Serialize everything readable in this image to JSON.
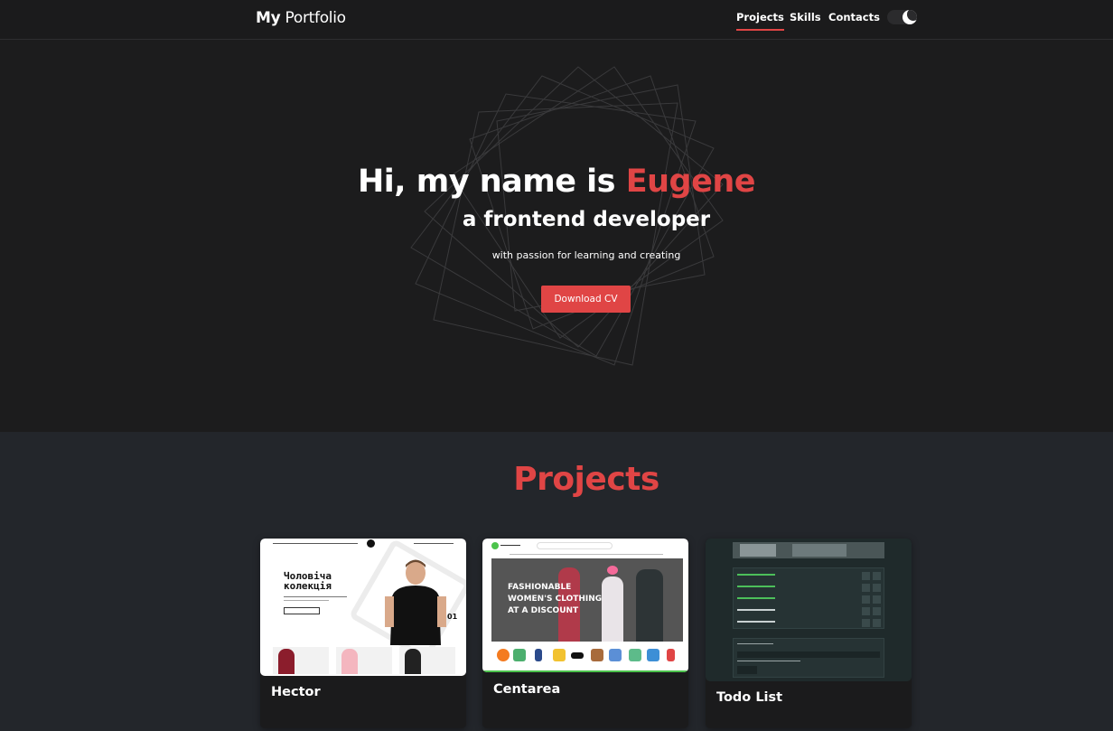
{
  "header": {
    "brand_bold": "My",
    "brand_rest": "Portfolio",
    "nav": [
      "Projects",
      "Skills",
      "Contacts"
    ],
    "active_nav": "Projects",
    "theme_toggle": "dark"
  },
  "hero": {
    "title_prefix": "Hi, my name is ",
    "title_name": "Eugene",
    "subtitle": "a frontend developer",
    "tagline": "with passion for learning and creating",
    "cv_button": "Download CV"
  },
  "projects": {
    "title": "Projects",
    "items": [
      {
        "name": "Hector",
        "preview_heading": "Чоловіча колекція",
        "slide_number": "01"
      },
      {
        "name": "Centarea",
        "preview_heading": "FASHIONABLE WOMEN'S CLOTHING AT A DISCOUNT"
      },
      {
        "name": "Todo List"
      }
    ]
  },
  "colors": {
    "accent": "#e04545",
    "page_background": "#1c1c1d",
    "projects_background": "#23262b",
    "card_background": "#1b1b1c"
  }
}
